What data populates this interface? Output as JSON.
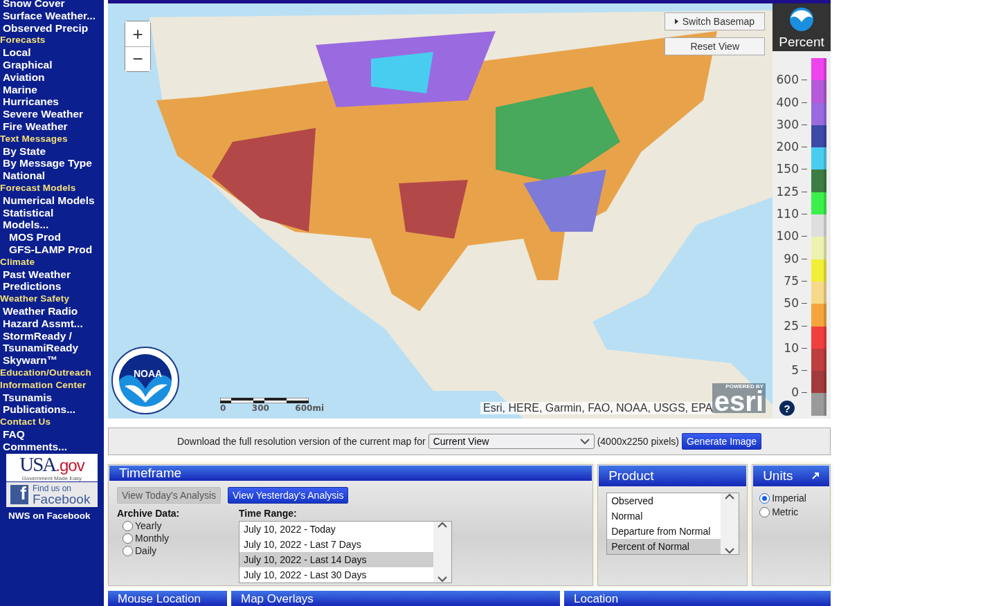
{
  "sidebar": {
    "items": [
      {
        "kind": "link",
        "label": "Snow Cover",
        "indent": false
      },
      {
        "kind": "link",
        "label": "Surface Weather...",
        "indent": false
      },
      {
        "kind": "link",
        "label": "Observed Precip",
        "indent": false
      },
      {
        "kind": "header",
        "label": "Forecasts"
      },
      {
        "kind": "link",
        "label": "Local",
        "indent": false
      },
      {
        "kind": "link",
        "label": "Graphical",
        "indent": false
      },
      {
        "kind": "link",
        "label": "Aviation",
        "indent": false
      },
      {
        "kind": "link",
        "label": "Marine",
        "indent": false
      },
      {
        "kind": "link",
        "label": "Hurricanes",
        "indent": false
      },
      {
        "kind": "link",
        "label": "Severe Weather",
        "indent": false
      },
      {
        "kind": "link",
        "label": "Fire Weather",
        "indent": false
      },
      {
        "kind": "header",
        "label": "Text Messages"
      },
      {
        "kind": "link",
        "label": "By State",
        "indent": false
      },
      {
        "kind": "link",
        "label": "By Message Type",
        "indent": false
      },
      {
        "kind": "link",
        "label": "National",
        "indent": false
      },
      {
        "kind": "header",
        "label": "Forecast Models"
      },
      {
        "kind": "link",
        "label": "Numerical Models",
        "indent": false
      },
      {
        "kind": "link",
        "label": "Statistical",
        "indent": false
      },
      {
        "kind": "link",
        "label": "Models...",
        "indent": false
      },
      {
        "kind": "link",
        "label": "MOS Prod",
        "indent": true
      },
      {
        "kind": "link",
        "label": "GFS-LAMP Prod",
        "indent": true
      },
      {
        "kind": "header",
        "label": "Climate"
      },
      {
        "kind": "link",
        "label": "Past Weather",
        "indent": false
      },
      {
        "kind": "link",
        "label": "Predictions",
        "indent": false
      },
      {
        "kind": "header",
        "label": "Weather Safety"
      },
      {
        "kind": "link",
        "label": "Weather Radio",
        "indent": false
      },
      {
        "kind": "link",
        "label": "Hazard Assmt...",
        "indent": false
      },
      {
        "kind": "link",
        "label": "StormReady /",
        "indent": false
      },
      {
        "kind": "link",
        "label": "TsunamiReady",
        "indent": false
      },
      {
        "kind": "link",
        "label": "Skywarn™",
        "indent": false
      },
      {
        "kind": "header",
        "label": "Education/Outreach"
      },
      {
        "kind": "header",
        "label": "Information Center"
      },
      {
        "kind": "link",
        "label": "Tsunamis",
        "indent": false
      },
      {
        "kind": "link",
        "label": "Publications...",
        "indent": false
      },
      {
        "kind": "header",
        "label": "Contact Us"
      },
      {
        "kind": "link",
        "label": "FAQ",
        "indent": false
      },
      {
        "kind": "link",
        "label": "Comments...",
        "indent": false
      }
    ],
    "usagov": {
      "main": "USA",
      "tld": ".gov",
      "tagline": "Government Made Easy"
    },
    "facebook": {
      "icon": "f",
      "top": "Find us on",
      "brand": "Facebook",
      "caption": "NWS on Facebook"
    }
  },
  "map": {
    "zoom_in": "+",
    "zoom_out": "−",
    "switch_basemap": "Switch Basemap",
    "reset_view": "Reset View",
    "attribution": "Esri, HERE, Garmin, FAO, NOAA, USGS, EPA",
    "scale_labels": [
      "0",
      "300",
      "600mi"
    ],
    "esri_top": "POWERED BY",
    "esri": "esri",
    "noaa": "NOAA"
  },
  "legend": {
    "title": "Percent",
    "help": "?",
    "items": [
      {
        "label": "600",
        "color": "#ee44ee"
      },
      {
        "label": "400",
        "color": "#b55ad8"
      },
      {
        "label": "300",
        "color": "#9a6ae0"
      },
      {
        "label": "200",
        "color": "#3d4aa8"
      },
      {
        "label": "150",
        "color": "#48cdf0"
      },
      {
        "label": "125",
        "color": "#3d7d44"
      },
      {
        "label": "110",
        "color": "#3cf04c"
      },
      {
        "label": "100",
        "color": "#dedede"
      },
      {
        "label": "90",
        "color": "#eef2b0"
      },
      {
        "label": "75",
        "color": "#f2ef38"
      },
      {
        "label": "50",
        "color": "#f6d98a"
      },
      {
        "label": "25",
        "color": "#f4a63c"
      },
      {
        "label": "10",
        "color": "#f13f3f"
      },
      {
        "label": "5",
        "color": "#bf3e3e"
      },
      {
        "label": "0",
        "color": "#a23c3c"
      },
      {
        "color": "#9a9a9a"
      }
    ]
  },
  "download": {
    "text": "Download the full resolution version of the current map for",
    "select": "Current View",
    "size": "(4000x2250 pixels)",
    "button": "Generate Image"
  },
  "timeframe": {
    "title": "Timeframe",
    "buttons": [
      {
        "label": "View Today's Analysis",
        "selected": true
      },
      {
        "label": "View Yesterday's Analysis",
        "selected": false
      }
    ],
    "archive_label": "Archive Data:",
    "archive": [
      {
        "label": "Yearly",
        "selected": false
      },
      {
        "label": "Monthly",
        "selected": false
      },
      {
        "label": "Daily",
        "selected": false
      }
    ],
    "range_label": "Time Range:",
    "ranges": [
      {
        "label": "July 10, 2022 - Today",
        "selected": false
      },
      {
        "label": "July 10, 2022 - Last 7 Days",
        "selected": false
      },
      {
        "label": "July 10, 2022 - Last 14 Days",
        "selected": true
      },
      {
        "label": "July 10, 2022 - Last 30 Days",
        "selected": false
      }
    ]
  },
  "product": {
    "title": "Product",
    "options": [
      {
        "label": "Observed",
        "selected": false
      },
      {
        "label": "Normal",
        "selected": false
      },
      {
        "label": "Departure from Normal",
        "selected": false
      },
      {
        "label": "Percent of Normal",
        "selected": true
      }
    ]
  },
  "units": {
    "title": "Units",
    "options": [
      {
        "label": "Imperial",
        "selected": true
      },
      {
        "label": "Metric",
        "selected": false
      }
    ]
  },
  "bottom_panels": [
    "Mouse Location",
    "Map Overlays",
    "Location"
  ]
}
